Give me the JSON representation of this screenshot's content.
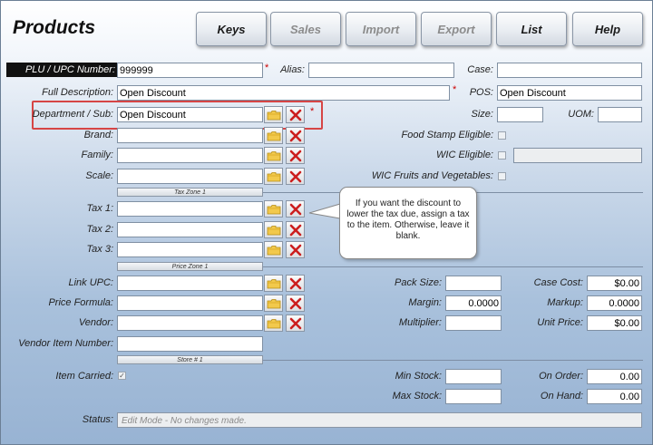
{
  "title": "Products",
  "toolbar": [
    {
      "label": "Keys",
      "enabled": true
    },
    {
      "label": "Sales",
      "enabled": false
    },
    {
      "label": "Import",
      "enabled": false
    },
    {
      "label": "Export",
      "enabled": false
    },
    {
      "label": "List",
      "enabled": true
    },
    {
      "label": "Help",
      "enabled": true
    }
  ],
  "fields": {
    "plu_label": "PLU / UPC Number:",
    "plu_value": "999999",
    "alias_label": "Alias:",
    "alias_value": "",
    "case_label": "Case:",
    "case_value": "",
    "full_desc_label": "Full Description:",
    "full_desc_value": "Open Discount",
    "pos_label": "POS:",
    "pos_value": "Open Discount",
    "dept_label": "Department / Sub:",
    "dept_value": "Open Discount",
    "size_label": "Size:",
    "size_value": "",
    "uom_label": "UOM:",
    "uom_value": "",
    "brand_label": "Brand:",
    "family_label": "Family:",
    "scale_label": "Scale:",
    "food_stamp_label": "Food Stamp Eligible:",
    "wic_label": "WIC Eligible:",
    "wic_fruits_label": "WIC Fruits and Vegetables:",
    "tax_zone_label": "Tax Zone 1",
    "tax1_label": "Tax 1:",
    "tax2_label": "Tax 2:",
    "tax3_label": "Tax 3:",
    "price_zone_label": "Price Zone 1",
    "link_upc_label": "Link UPC:",
    "price_formula_label": "Price Formula:",
    "vendor_label": "Vendor:",
    "vendor_item_label": "Vendor Item Number:",
    "store_label": "Store # 1",
    "pack_size_label": "Pack Size:",
    "pack_size_value": "",
    "margin_label": "Margin:",
    "margin_value": "0.0000",
    "multiplier_label": "Multiplier:",
    "multiplier_value": "",
    "case_cost_label": "Case Cost:",
    "case_cost_value": "$0.00",
    "markup_label": "Markup:",
    "markup_value": "0.0000",
    "unit_price_label": "Unit Price:",
    "unit_price_value": "$0.00",
    "item_carried_label": "Item Carried:",
    "item_carried_checked": true,
    "min_stock_label": "Min Stock:",
    "min_stock_value": "",
    "max_stock_label": "Max Stock:",
    "max_stock_value": "",
    "on_order_label": "On Order:",
    "on_order_value": "0.00",
    "on_hand_label": "On Hand:",
    "on_hand_value": "0.00",
    "status_label": "Status:",
    "status_value": "Edit Mode - No changes made."
  },
  "required_mark": "*",
  "callout_text": "If you want the discount to lower the tax due, assign a tax to the item. Otherwise, leave it blank.",
  "icons": {
    "browse": "folder-icon",
    "clear": "red-x-icon"
  },
  "colors": {
    "highlight": "#d64545",
    "required": "#cc0000",
    "folder": "#e8b92f",
    "clear": "#cc1e1e"
  }
}
